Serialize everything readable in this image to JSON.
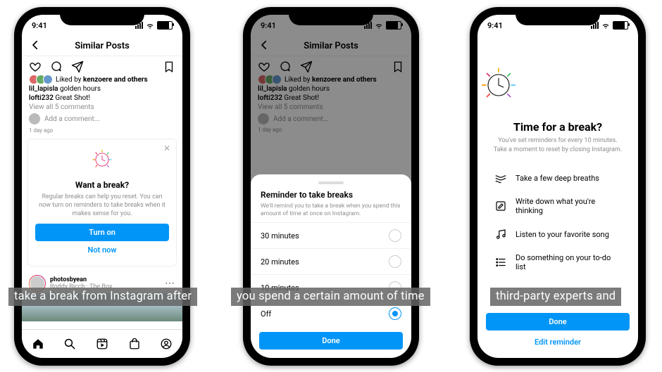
{
  "status": {
    "time": "9:41"
  },
  "header": {
    "title": "Similar Posts"
  },
  "post": {
    "liked_by_prefix": "Liked by ",
    "liked_by_user": "kenzoere",
    "liked_by_suffix": " and others",
    "cap1_user": "lil_lapisla",
    "cap1_text": " golden hours",
    "cap2_user": "lofti232",
    "cap2_text": " Great Shot!",
    "view_all": "View all 5 comments",
    "add_comment": "Add a comment...",
    "age": "1 day ago"
  },
  "prompt_card": {
    "title": "Want a break?",
    "body": "Regular breaks can help you reset. You can now turn on reminders to take breaks when it makes sense for you.",
    "primary": "Turn on",
    "secondary": "Not now"
  },
  "next_post": {
    "user": "photosbyean",
    "sub": "Roddy Ricch · The Box"
  },
  "sheet": {
    "title": "Reminder to take breaks",
    "desc": "We'll remind you to take a break when you spend this amount of time at once on Instagram.",
    "options": [
      "30 minutes",
      "20 minutes",
      "10 minutes",
      "Off"
    ],
    "selected_index": 3,
    "done": "Done"
  },
  "break_prompt": {
    "title": "Time for a break?",
    "sub": "You've set reminders for every 10 minutes. Take a moment to reset by closing Instagram.",
    "tips": [
      "Take a few deep breaths",
      "Write down what you're thinking",
      "Listen to your favorite song",
      "Do something on your to-do list"
    ],
    "primary": "Done",
    "secondary": "Edit reminder"
  },
  "captions": {
    "c1": "take a break from Instagram after",
    "c2": "you spend a certain amount of time",
    "c3": "third-party experts and"
  }
}
